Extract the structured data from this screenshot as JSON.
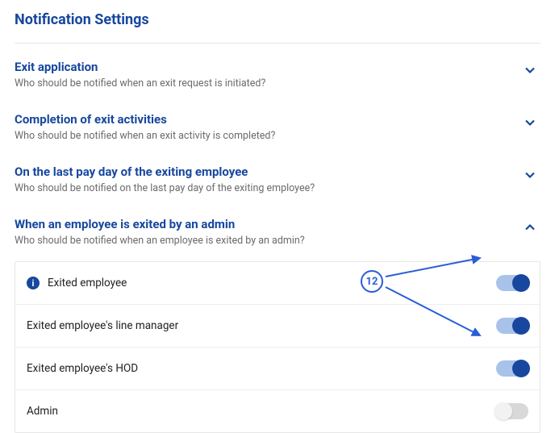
{
  "page": {
    "title": "Notification Settings"
  },
  "sections": [
    {
      "title": "Exit application",
      "desc": "Who should be notified when an exit request is initiated?",
      "expanded": false
    },
    {
      "title": "Completion of exit activities",
      "desc": "Who should be notified when an exit activity is completed?",
      "expanded": false
    },
    {
      "title": "On the last pay day of the exiting employee",
      "desc": "Who should be notified on the last pay day of the exiting employee?",
      "expanded": false
    },
    {
      "title": "When an employee is exited by an admin",
      "desc": "Who should be notified when an employee is exited by an admin?",
      "expanded": true,
      "options": [
        {
          "label": "Exited employee",
          "info": true,
          "on": true
        },
        {
          "label": "Exited employee's line manager",
          "info": false,
          "on": true
        },
        {
          "label": "Exited employee's HOD",
          "info": false,
          "on": true
        },
        {
          "label": "Admin",
          "info": false,
          "on": false
        }
      ]
    }
  ],
  "annotation": {
    "label": "12"
  }
}
